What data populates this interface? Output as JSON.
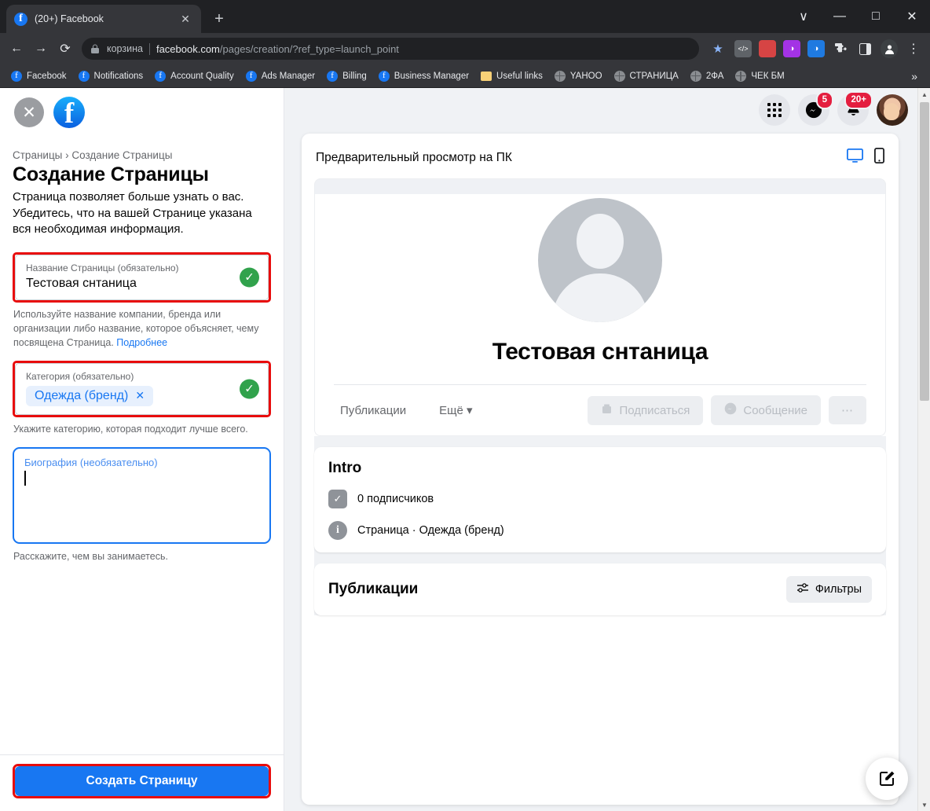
{
  "browser": {
    "tab": {
      "title": "(20+) Facebook",
      "favicon": "facebook-icon",
      "close": "✕"
    },
    "new_tab": "+",
    "window_controls": {
      "minimize_group": "∨",
      "minimize": "—",
      "maximize": "□",
      "close": "✕"
    },
    "nav": {
      "back": "←",
      "forward": "→",
      "reload": "⟳"
    },
    "omnibox": {
      "site_label": "корзина",
      "url_domain": "facebook.com",
      "url_path": "/pages/creation/?ref_type=launch_point",
      "lock": "lock-icon",
      "star": "★"
    },
    "extensions": [
      {
        "name": "code-extension-icon",
        "glyph": "</>",
        "color": "#5f6368"
      },
      {
        "name": "adblock-extension-icon",
        "glyph": "●",
        "color": "#d64444"
      },
      {
        "name": "purple-extension-icon",
        "glyph": "◑",
        "color": "#a333e5"
      },
      {
        "name": "blue-extension-icon",
        "glyph": "◑",
        "color": "#1f7ae0"
      },
      {
        "name": "puzzle-extensions-icon",
        "glyph": "❖",
        "color": "transparent"
      },
      {
        "name": "sidepanel-icon",
        "glyph": "▣",
        "color": "transparent"
      },
      {
        "name": "profile-avatar-icon",
        "glyph": "●",
        "color": "#000000"
      },
      {
        "name": "chrome-menu-icon",
        "glyph": "⋮",
        "color": "transparent"
      }
    ],
    "bookmarks": [
      {
        "label": "Facebook",
        "icon": "facebook-icon"
      },
      {
        "label": "Notifications",
        "icon": "facebook-icon"
      },
      {
        "label": "Account Quality",
        "icon": "facebook-icon"
      },
      {
        "label": "Ads Manager",
        "icon": "facebook-icon"
      },
      {
        "label": "Billing",
        "icon": "facebook-icon"
      },
      {
        "label": "Business Manager",
        "icon": "facebook-icon"
      },
      {
        "label": "Useful links",
        "icon": "folder-icon"
      },
      {
        "label": "YAHOO",
        "icon": "globe-icon"
      },
      {
        "label": "СТРАНИЦА",
        "icon": "globe-icon"
      },
      {
        "label": "2ФА",
        "icon": "globe-icon"
      },
      {
        "label": "ЧЕК БМ",
        "icon": "globe-icon"
      }
    ],
    "bookmarks_overflow": "»"
  },
  "sidebar": {
    "close_icon": "✕",
    "logo": "f",
    "breadcrumb": "Страницы › Создание Страницы",
    "title": "Создание Страницы",
    "description": "Страница позволяет больше узнать о вас. Убедитесь, что на вашей Странице указана вся необходимая информация.",
    "name_field": {
      "label": "Название Страницы (обязательно)",
      "value": "Тестовая снтаница",
      "valid_icon": "✓"
    },
    "name_helper": "Используйте название компании, бренда или организации либо название, которое объясняет, чему посвящена Страница.",
    "name_helper_link": "Подробнее",
    "category_field": {
      "label": "Категория (обязательно)",
      "chip": "Одежда (бренд)",
      "chip_remove": "✕",
      "valid_icon": "✓"
    },
    "category_helper": "Укажите категорию, которая подходит лучше всего.",
    "bio_field": {
      "label": "Биография (необязательно)",
      "value": ""
    },
    "bio_helper": "Расскажите, чем вы занимаетесь.",
    "submit_label": "Создать Страницу"
  },
  "topbar": {
    "menu_icon": "grid-menu-icon",
    "messenger_icon": "messenger-icon",
    "messenger_badge": "5",
    "notifications_icon": "bell-icon",
    "notifications_badge": "20+",
    "avatar": "user-avatar"
  },
  "preview": {
    "header_title": "Предварительный просмотр на ПК",
    "desktop_icon": "desktop-icon",
    "mobile_icon": "mobile-icon",
    "page_name": "Тестовая снтаница",
    "tabs": [
      {
        "label": "Публикации"
      },
      {
        "label": "Ещё",
        "caret": "▾"
      }
    ],
    "actions": [
      {
        "label": "Подписаться",
        "icon": "follow-icon"
      },
      {
        "label": "Сообщение",
        "icon": "messenger-icon"
      }
    ],
    "more_dots": "⋯",
    "intro": {
      "title": "Intro",
      "rows": [
        {
          "icon": "followers-icon",
          "text": "0 подписчиков"
        },
        {
          "icon": "info-icon",
          "text": "Страница · Одежда (бренд)"
        }
      ]
    },
    "posts": {
      "title": "Публикации",
      "filter_label": "Фильтры",
      "filter_icon": "sliders-icon"
    },
    "fab_icon": "compose-icon"
  },
  "colors": {
    "accent": "#1877F2",
    "highlight_red": "#e80c0c",
    "success_green": "#31a24c",
    "badge_red": "#e41e3f"
  }
}
